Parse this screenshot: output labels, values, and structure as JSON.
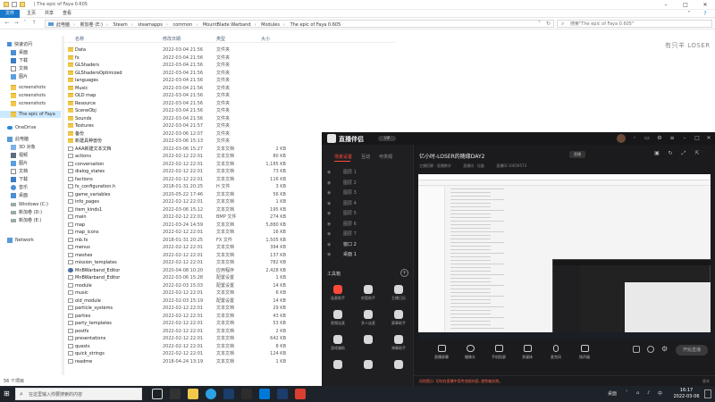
{
  "explorer": {
    "window_title": "| The epic of Faya 0.605",
    "ribbon_tabs": [
      "文件",
      "主页",
      "共享",
      "查看"
    ],
    "address_crumbs": [
      "此电脑",
      "新加卷 (E:)",
      "Steam",
      "steamapps",
      "common",
      "MountBlade Warband",
      "Modules",
      "The epic of Faya 0.605"
    ],
    "search_placeholder": "搜索\"The epic of Faya 0.605\"",
    "columns": {
      "name": "名称",
      "date": "修改日期",
      "type": "类型",
      "size": "大小"
    },
    "sidebar": [
      {
        "label": "快速访问",
        "icon": "star-icon"
      },
      {
        "label": "桌面",
        "icon": "desktop-icon"
      },
      {
        "label": "下载",
        "icon": "download-icon"
      },
      {
        "label": "文档",
        "icon": "document-icon"
      },
      {
        "label": "图片",
        "icon": "picture-icon"
      },
      {
        "label": "screenshots",
        "icon": "folder-icon"
      },
      {
        "label": "screenshots",
        "icon": "folder-icon"
      },
      {
        "label": "screenshots",
        "icon": "folder-icon"
      },
      {
        "label": "The epic of Faya",
        "icon": "folder-icon"
      },
      {
        "label": "OneDrive",
        "icon": "cloud-icon"
      },
      {
        "label": "此电脑",
        "icon": "computer-icon"
      },
      {
        "label": "3D 对象",
        "icon": "cube-icon"
      },
      {
        "label": "视频",
        "icon": "video-icon"
      },
      {
        "label": "图片",
        "icon": "picture-icon"
      },
      {
        "label": "文档",
        "icon": "document-icon"
      },
      {
        "label": "下载",
        "icon": "download-icon"
      },
      {
        "label": "音乐",
        "icon": "music-icon"
      },
      {
        "label": "桌面",
        "icon": "desktop-icon"
      },
      {
        "label": "Windows (C:)",
        "icon": "drive-icon"
      },
      {
        "label": "新加卷 (D:)",
        "icon": "drive-icon"
      },
      {
        "label": "新加卷 (E:)",
        "icon": "drive-icon"
      },
      {
        "label": "Network",
        "icon": "network-icon"
      }
    ],
    "files": [
      {
        "name": "Data",
        "date": "2022-03-04 21:56",
        "type": "文件夹",
        "size": "",
        "kind": "folder"
      },
      {
        "name": "fx",
        "date": "2022-03-04 21:56",
        "type": "文件夹",
        "size": "",
        "kind": "folder"
      },
      {
        "name": "GLShaders",
        "date": "2022-03-04 21:56",
        "type": "文件夹",
        "size": "",
        "kind": "folder"
      },
      {
        "name": "GLShadersOptimized",
        "date": "2022-03-04 21:56",
        "type": "文件夹",
        "size": "",
        "kind": "folder"
      },
      {
        "name": "languages",
        "date": "2022-03-04 21:56",
        "type": "文件夹",
        "size": "",
        "kind": "folder"
      },
      {
        "name": "Music",
        "date": "2022-03-04 21:56",
        "type": "文件夹",
        "size": "",
        "kind": "folder"
      },
      {
        "name": "OLD map",
        "date": "2022-03-04 21:56",
        "type": "文件夹",
        "size": "",
        "kind": "folder"
      },
      {
        "name": "Resource",
        "date": "2022-03-04 21:56",
        "type": "文件夹",
        "size": "",
        "kind": "folder"
      },
      {
        "name": "SceneObj",
        "date": "2022-03-04 21:56",
        "type": "文件夹",
        "size": "",
        "kind": "folder"
      },
      {
        "name": "Sounds",
        "date": "2022-03-04 21:56",
        "type": "文件夹",
        "size": "",
        "kind": "folder"
      },
      {
        "name": "Textures",
        "date": "2022-03-04 21:57",
        "type": "文件夹",
        "size": "",
        "kind": "folder"
      },
      {
        "name": "备份",
        "date": "2022-03-06 12:07",
        "type": "文件夹",
        "size": "",
        "kind": "folder"
      },
      {
        "name": "新建具种兽份",
        "date": "2022-03-06 15:13",
        "type": "文件夹",
        "size": "",
        "kind": "folder"
      },
      {
        "name": "AAA新建文本文档",
        "date": "2022-03-06 15:27",
        "type": "文本文档",
        "size": "2 KB",
        "kind": "doc"
      },
      {
        "name": "actions",
        "date": "2022-02-12 22:01",
        "type": "文本文档",
        "size": "80 KB",
        "kind": "doc"
      },
      {
        "name": "conversation",
        "date": "2022-02-12 22:01",
        "type": "文本文档",
        "size": "1,185 KB",
        "kind": "doc"
      },
      {
        "name": "dialog_states",
        "date": "2022-02-12 22:01",
        "type": "文本文档",
        "size": "73 KB",
        "kind": "doc"
      },
      {
        "name": "factions",
        "date": "2022-02-12 22:01",
        "type": "文本文档",
        "size": "116 KB",
        "kind": "doc"
      },
      {
        "name": "fx_configuration.h",
        "date": "2018-01-31 20:25",
        "type": "H 文件",
        "size": "3 KB",
        "kind": "doc"
      },
      {
        "name": "game_variables",
        "date": "2020-05-22 17:46",
        "type": "文本文档",
        "size": "56 KB",
        "kind": "doc"
      },
      {
        "name": "info_pages",
        "date": "2022-02-12 22:01",
        "type": "文本文档",
        "size": "1 KB",
        "kind": "doc"
      },
      {
        "name": "item_kinds1",
        "date": "2022-03-06 15:12",
        "type": "文本文档",
        "size": "195 KB",
        "kind": "doc"
      },
      {
        "name": "main",
        "date": "2022-02-12 22:01",
        "type": "BMP 文件",
        "size": "274 KB",
        "kind": "doc"
      },
      {
        "name": "map",
        "date": "2021-03-24 14:59",
        "type": "文本文档",
        "size": "5,880 KB",
        "kind": "doc"
      },
      {
        "name": "map_icons",
        "date": "2022-02-12 22:01",
        "type": "文本文档",
        "size": "16 KB",
        "kind": "doc"
      },
      {
        "name": "mb.fx",
        "date": "2018-01-31 20:25",
        "type": "FX 文件",
        "size": "1,505 KB",
        "kind": "doc"
      },
      {
        "name": "menus",
        "date": "2022-02-12 22:01",
        "type": "文本文档",
        "size": "394 KB",
        "kind": "doc"
      },
      {
        "name": "meshes",
        "date": "2022-02-12 22:01",
        "type": "文本文档",
        "size": "137 KB",
        "kind": "doc"
      },
      {
        "name": "mission_templates",
        "date": "2022-02-12 22:01",
        "type": "文本文档",
        "size": "782 KB",
        "kind": "doc"
      },
      {
        "name": "MnBWarband_Editor",
        "date": "2020-04-08 10:20",
        "type": "应用程序",
        "size": "2,428 KB",
        "kind": "app"
      },
      {
        "name": "MnBWarband_Editor",
        "date": "2022-03-06 15:28",
        "type": "配置设置",
        "size": "1 KB",
        "kind": "doc"
      },
      {
        "name": "module",
        "date": "2022-02-03 15:03",
        "type": "配置设置",
        "size": "14 KB",
        "kind": "doc"
      },
      {
        "name": "music",
        "date": "2022-02-12 22:01",
        "type": "文本文档",
        "size": "6 KB",
        "kind": "doc"
      },
      {
        "name": "old_module",
        "date": "2022-02-03 15:19",
        "type": "配置设置",
        "size": "14 KB",
        "kind": "doc"
      },
      {
        "name": "particle_systems",
        "date": "2022-02-12 22:01",
        "type": "文本文档",
        "size": "29 KB",
        "kind": "doc"
      },
      {
        "name": "parties",
        "date": "2022-02-12 22:01",
        "type": "文本文档",
        "size": "43 KB",
        "kind": "doc"
      },
      {
        "name": "party_templates",
        "date": "2022-02-12 22:01",
        "type": "文本文档",
        "size": "53 KB",
        "kind": "doc"
      },
      {
        "name": "postfx",
        "date": "2022-02-12 22:01",
        "type": "文本文档",
        "size": "2 KB",
        "kind": "doc"
      },
      {
        "name": "presentations",
        "date": "2022-02-12 22:01",
        "type": "文本文档",
        "size": "642 KB",
        "kind": "doc"
      },
      {
        "name": "quests",
        "date": "2022-02-12 22:01",
        "type": "文本文档",
        "size": "8 KB",
        "kind": "doc"
      },
      {
        "name": "quick_strings",
        "date": "2022-02-12 22:01",
        "type": "文本文档",
        "size": "124 KB",
        "kind": "doc"
      },
      {
        "name": "readme",
        "date": "2018-04-24 13:19",
        "type": "文本文档",
        "size": "1 KB",
        "kind": "doc"
      }
    ],
    "status": "56 个项目",
    "watermark": "有只羊 LOSER"
  },
  "stream": {
    "app_name": "直播伴侣",
    "vip_badge": "VIP",
    "tabs": [
      "场景设置",
      "互动",
      "可供观"
    ],
    "layers": [
      {
        "label": "图层 1"
      },
      {
        "label": "图层 2"
      },
      {
        "label": "图层 3"
      },
      {
        "label": "图层 4"
      },
      {
        "label": "图层 5"
      },
      {
        "label": "图层 6"
      },
      {
        "label": "图层 7"
      },
      {
        "label": "窗口 2"
      },
      {
        "label": "桌面 1"
      }
    ],
    "tools_header": "工具箱",
    "tools": [
      "连麦助手",
      "房管助手",
      "主播日历",
      "视频连麦",
      "多人连麦",
      "赛事助手",
      "游戏辅助",
      "",
      "弹幕助手",
      "",
      "",
      ""
    ],
    "stream_title": "亿小时-LOSER的随缘DAY2",
    "stream_tag": "直播",
    "subline": [
      "主播招募 · 直播教学",
      "直播间 · 设备",
      "直播ID 10059573"
    ],
    "bottom_buttons": [
      "直播屏幕",
      "摄像头",
      "手机投屏",
      "多媒体",
      "麦克风",
      "扬声器"
    ],
    "go_live": "开始直播",
    "notice": "风险提示: 切勿在直播中宣传违规内容, 避免被封禁。",
    "version": "版本"
  },
  "taskbar": {
    "search_placeholder": "在这里输入你要搜索的内容",
    "time": "16:17",
    "date": "2022-03-06",
    "tray_label": "桌面"
  },
  "colors": {
    "accent": "#1979ca",
    "stream_red": "#ff4a3a",
    "folder": "#f2c84b"
  }
}
